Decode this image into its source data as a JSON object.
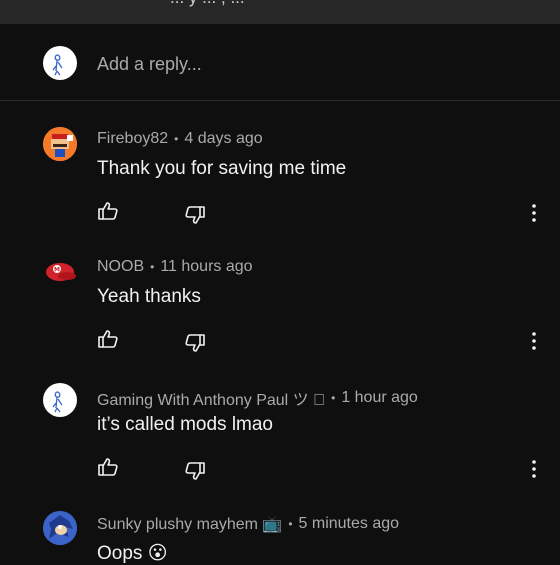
{
  "topbar": {
    "partial_text": "... y ... , ..."
  },
  "reply": {
    "placeholder": "Add a reply..."
  },
  "comments": [
    {
      "author": "Fireboy82",
      "time": "4 days ago",
      "text": "Thank you for saving me time",
      "avatar": "mario-pixel-avatar"
    },
    {
      "author": "NOOB",
      "time": "11 hours ago",
      "text": "Yeah thanks",
      "avatar": "red-cap-avatar"
    },
    {
      "author": "Gaming With Anthony Paul ツ ",
      "time": "1 hour ago",
      "text": "it’s called mods lmao",
      "avatar": "stick-figure-avatar"
    },
    {
      "author": "Sunky plushy mayhem 📺",
      "time": "5 minutes ago",
      "text": "Oops 😮",
      "avatar": "sonic-avatar"
    }
  ],
  "icons": {
    "like": "thumbs-up-icon",
    "dislike": "thumbs-down-icon",
    "more": "more-vertical-icon"
  }
}
